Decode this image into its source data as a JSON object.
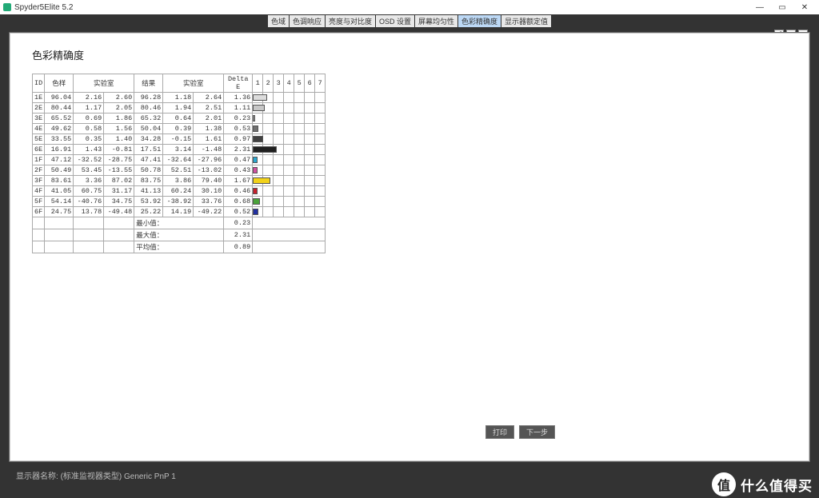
{
  "app": {
    "title": "Spyder5Elite 5.2"
  },
  "winbtns": {
    "min": "—",
    "restore": "▭",
    "close": "✕"
  },
  "tabs": {
    "items": [
      "色域",
      "色调响应",
      "亮度与对比度",
      "OSD 设置",
      "屏幕均匀性",
      "色彩精确度",
      "显示器额定值"
    ],
    "active": 5
  },
  "tools": {
    "zoom_out": "⤢",
    "zoom_fit": "▣",
    "zoom_actual": "⌕"
  },
  "section_title": "色彩精确度",
  "headers": {
    "id": "ID",
    "sample": "色样",
    "lab": "实验室",
    "result": "结果",
    "lab2": "实验室",
    "delta": "Delta E",
    "scale": [
      "1",
      "2",
      "3",
      "4",
      "5",
      "6",
      "7"
    ]
  },
  "summary_labels": {
    "min": "最小值：",
    "max": "最大值：",
    "avg": "平均值："
  },
  "summary_values": {
    "min": "0.23",
    "max": "2.31",
    "avg": "0.89"
  },
  "footer": {
    "label": "显示器名称:",
    "value": "(标准监视器类型) Generic PnP 1"
  },
  "footer_buttons": {
    "print": "打印",
    "next": "下一步"
  },
  "watermark": {
    "char": "值",
    "text": "什么值得买"
  },
  "chart_data": {
    "type": "bar",
    "title": "色彩精确度",
    "xlabel": "Delta E",
    "xlim": [
      0,
      7
    ],
    "rows": [
      {
        "id": "1E",
        "sample": [
          96.04,
          2.16,
          2.6
        ],
        "result": [
          96.28,
          1.18,
          2.64
        ],
        "delta": 1.36,
        "color": "#dcdcdc"
      },
      {
        "id": "2E",
        "sample": [
          80.44,
          1.17,
          2.05
        ],
        "result": [
          80.46,
          1.94,
          2.51
        ],
        "delta": 1.11,
        "color": "#c7c7c7"
      },
      {
        "id": "3E",
        "sample": [
          65.52,
          0.69,
          1.86
        ],
        "result": [
          65.32,
          0.64,
          2.01
        ],
        "delta": 0.23,
        "color": "#999999"
      },
      {
        "id": "4E",
        "sample": [
          49.62,
          0.58,
          1.56
        ],
        "result": [
          50.04,
          0.39,
          1.38
        ],
        "delta": 0.53,
        "color": "#707070"
      },
      {
        "id": "5E",
        "sample": [
          33.55,
          0.35,
          1.4
        ],
        "result": [
          34.28,
          -0.15,
          1.61
        ],
        "delta": 0.97,
        "color": "#404040"
      },
      {
        "id": "6E",
        "sample": [
          16.91,
          1.43,
          -0.81
        ],
        "result": [
          17.51,
          3.14,
          -1.48
        ],
        "delta": 2.31,
        "color": "#202020"
      },
      {
        "id": "1F",
        "sample": [
          47.12,
          -32.52,
          -28.75
        ],
        "result": [
          47.41,
          -32.64,
          -27.96
        ],
        "delta": 0.47,
        "color": "#2aa7d0"
      },
      {
        "id": "2F",
        "sample": [
          50.49,
          53.45,
          -13.55
        ],
        "result": [
          50.78,
          52.51,
          -13.02
        ],
        "delta": 0.43,
        "color": "#d14fa0"
      },
      {
        "id": "3F",
        "sample": [
          83.61,
          3.36,
          87.02
        ],
        "result": [
          83.75,
          3.86,
          79.4
        ],
        "delta": 1.67,
        "color": "#f2d21a"
      },
      {
        "id": "4F",
        "sample": [
          41.05,
          60.75,
          31.17
        ],
        "result": [
          41.13,
          60.24,
          30.1
        ],
        "delta": 0.46,
        "color": "#c8202c"
      },
      {
        "id": "5F",
        "sample": [
          54.14,
          -40.76,
          34.75
        ],
        "result": [
          53.92,
          -38.92,
          33.76
        ],
        "delta": 0.68,
        "color": "#4aa33a"
      },
      {
        "id": "6F",
        "sample": [
          24.75,
          13.78,
          -49.48
        ],
        "result": [
          25.22,
          14.19,
          -49.22
        ],
        "delta": 0.52,
        "color": "#2230a0"
      }
    ]
  }
}
